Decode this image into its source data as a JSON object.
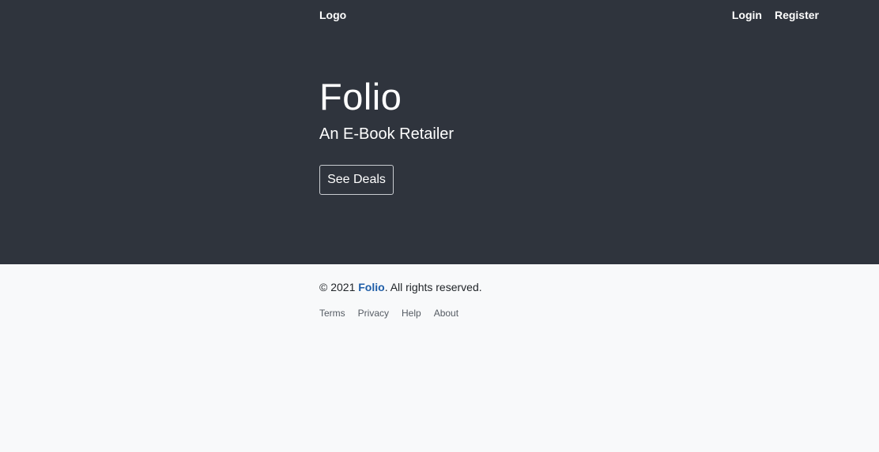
{
  "navbar": {
    "logo": "Logo",
    "links": [
      {
        "label": "Login"
      },
      {
        "label": "Register"
      }
    ]
  },
  "hero": {
    "title": "Folio",
    "subtitle": "An E-Book Retailer",
    "cta_label": "See Deals"
  },
  "footer": {
    "copyright_prefix": "© 2021 ",
    "brand": "Folio",
    "copyright_suffix": ". All rights reserved.",
    "links": [
      {
        "label": "Terms"
      },
      {
        "label": "Privacy"
      },
      {
        "label": "Help"
      },
      {
        "label": "About"
      }
    ]
  },
  "colors": {
    "hero_bg": "#2f343d",
    "footer_bg": "#f8f9fa",
    "brand_link": "#1f5ea8"
  }
}
